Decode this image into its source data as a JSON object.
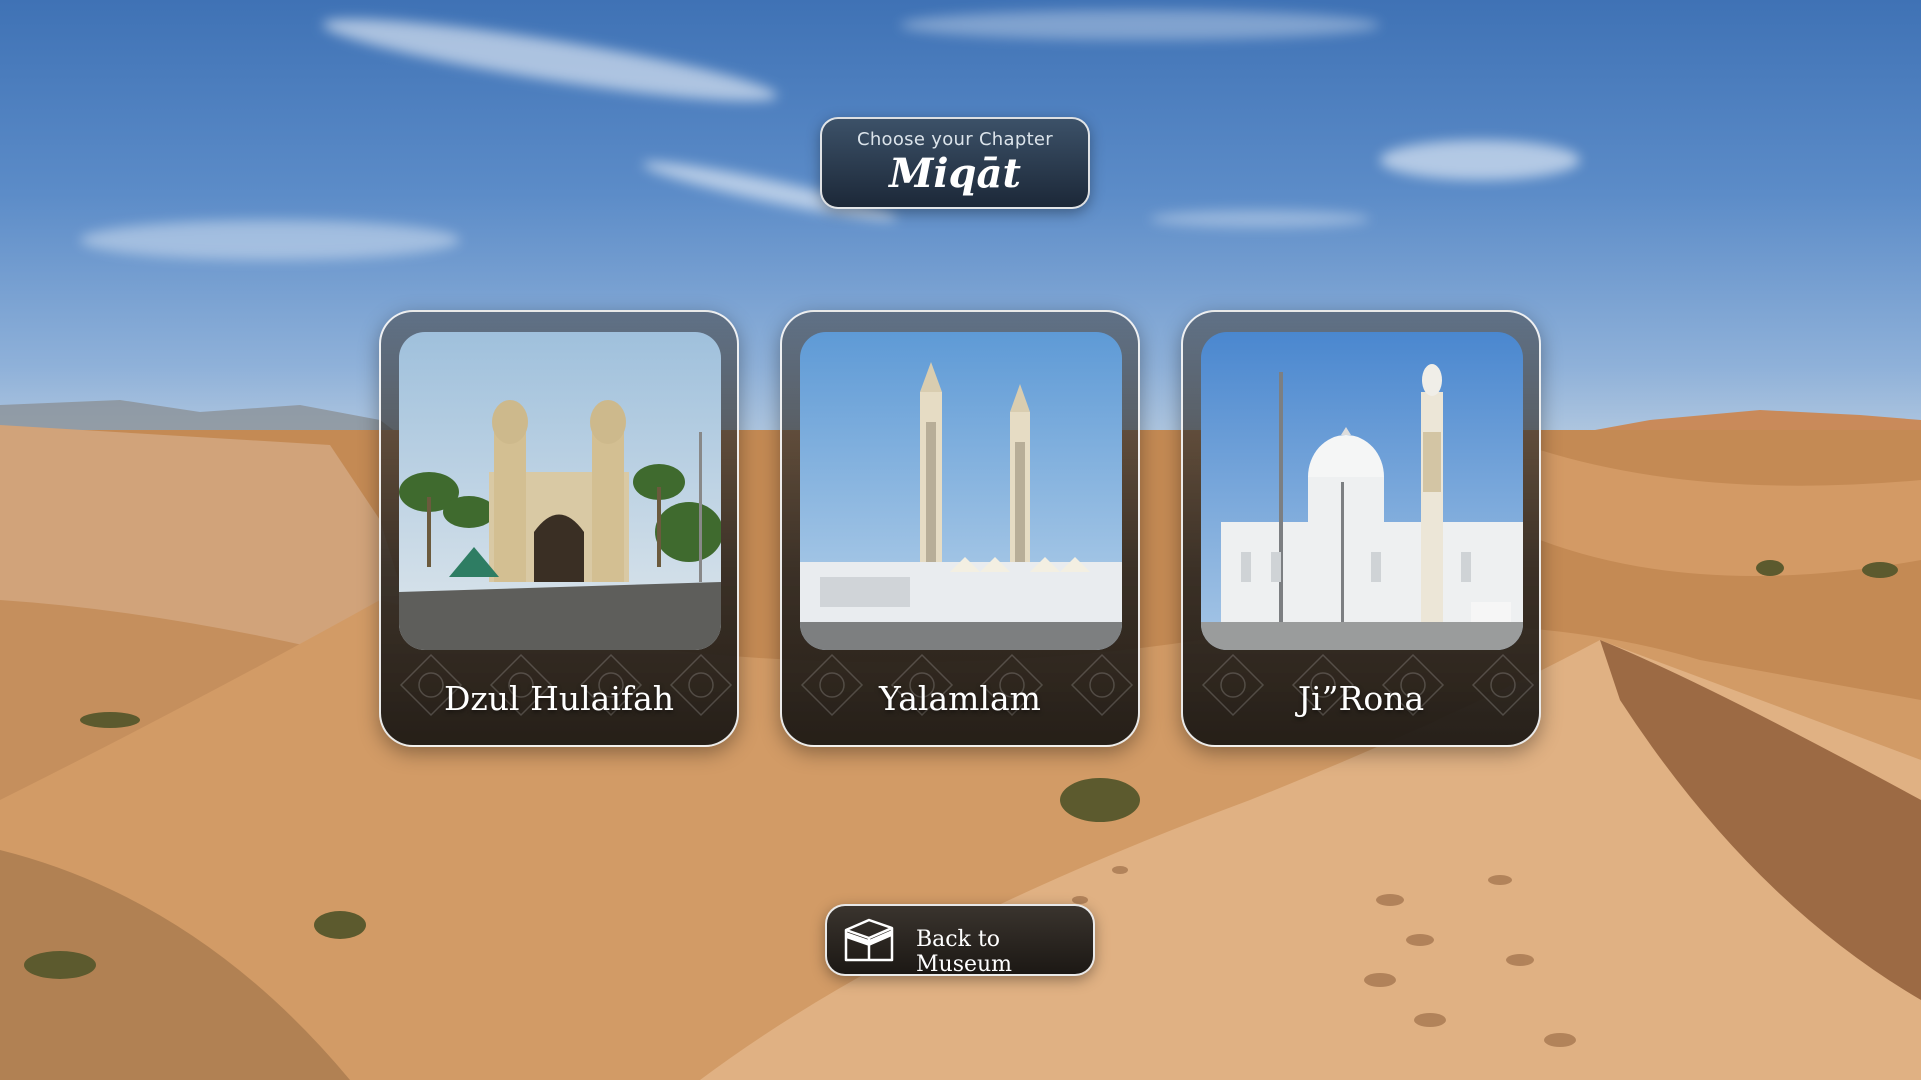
{
  "header": {
    "subtitle": "Choose your Chapter",
    "title": "Miqāt"
  },
  "chapters": [
    {
      "label": "Dzul Hulaifah",
      "image": "mosque-photo-dzul-hulaifah"
    },
    {
      "label": "Yalamlam",
      "image": "mosque-photo-yalamlam"
    },
    {
      "label": "Ji”Rona",
      "image": "mosque-photo-ji-rona"
    }
  ],
  "back_button": {
    "label": "Back to Museum",
    "icon": "kaaba-icon"
  },
  "colors": {
    "sky": "#5c8cc8",
    "sand": "#c98c52",
    "panel_dark": "#1c2838",
    "card_dark": "#28241f"
  }
}
